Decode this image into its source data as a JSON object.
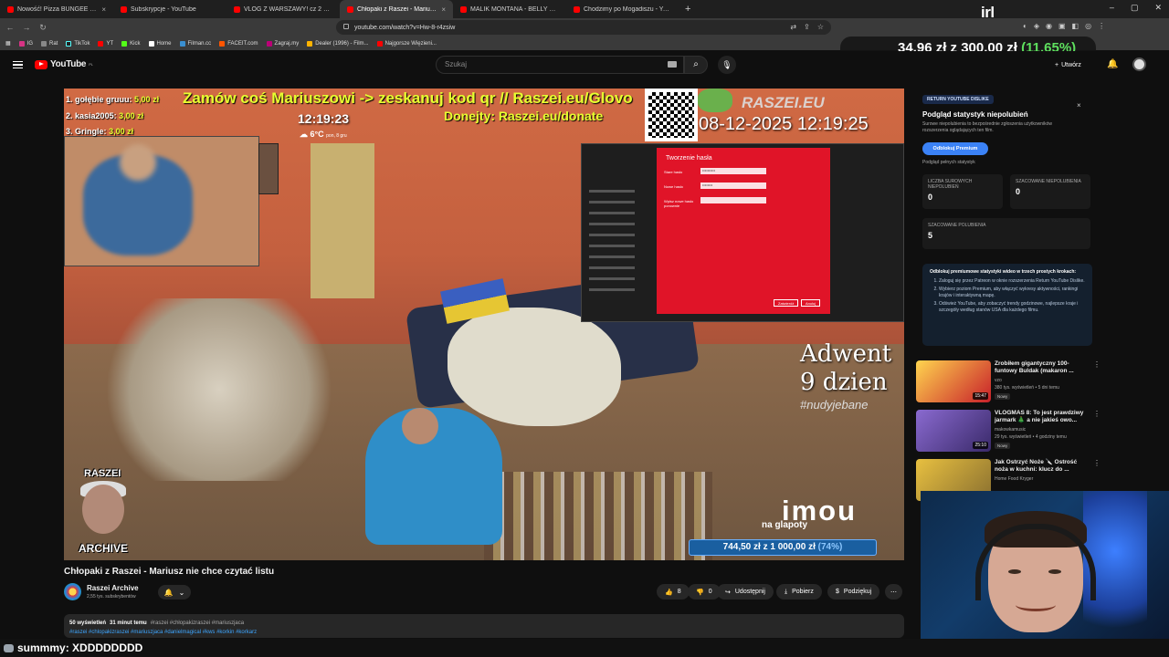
{
  "browser": {
    "tabs": [
      {
        "title": "Nowość! Pizza BUNGEE w Dino 🍕 😮",
        "active": false
      },
      {
        "title": "Subskrypcje - YouTube",
        "active": false
      },
      {
        "title": "VLOG Z WARSZAWY! cz 2 😮 - YouT",
        "active": false
      },
      {
        "title": "Chłopaki z Raszei - Mariusz n",
        "active": true
      },
      {
        "title": "MALIK MONTANA - BELLY DANCE X",
        "active": false
      },
      {
        "title": "Chodzimy po Mogadiszu - YouTube",
        "active": false
      }
    ],
    "url": "youtube.com/watch?v=Hw-8-r4zsiw",
    "stream_logo": "irl",
    "bookmarks": [
      "IG",
      "Rat",
      "TikTok",
      "YT",
      "Kick",
      "Home",
      "Filman.cc",
      "FACEIT.com",
      "Zagraj.my",
      "Dealer (1996) - Film...",
      "Najgorsze Więzieni..."
    ]
  },
  "donation_overlay": {
    "current": "34,96 zł",
    "separator": "z",
    "goal": "300,00 zł",
    "percent": "(11.65%)"
  },
  "yt_header": {
    "logo_text": "YouTube",
    "logo_region": "PL",
    "search_placeholder": "Szukaj",
    "create_label": "Utwórz"
  },
  "video_overlay": {
    "top_banner": "Zamów coś Mariuszowi -> zeskanuj kod qr // Raszei.eu/Glovo",
    "donate_banner": "Donejty: Raszei.eu/donate",
    "clock": "12:19:23",
    "temperature": "6°C",
    "weather_date": "pon, 8 gru",
    "leaderboard": [
      {
        "rank": "1.",
        "name": "gołębie gruuu:",
        "amount": "5,00 zł"
      },
      {
        "rank": "2.",
        "name": "kasia2005:",
        "amount": "3,00 zł"
      },
      {
        "rank": "3.",
        "name": "Gringle:",
        "amount": "3,00 zł"
      }
    ],
    "channel_logo": "RASZEI.EU",
    "cam_date": "08-12-2025 12:19:25",
    "dialog_title": "Tworzenie hasła",
    "dialog_fields": [
      "Stare hasło",
      "Nowe hasło",
      "Wpisz nowe hasło ponownie"
    ],
    "dialog_buttons": [
      "Zatwierdź",
      "Anuluj"
    ],
    "advent_line1": "Adwent",
    "advent_line2": "9 dzien",
    "advent_hashtag": "#nudyjebane",
    "cam_brand": "imou",
    "cam_brand_sub": "na glapoty",
    "goal_bar": {
      "current": "744,50 zł",
      "goal": "1 000,00 zł",
      "percent": "(74%)"
    },
    "archive_top": "RASZEI",
    "archive_bottom": "ARCHIVE"
  },
  "video": {
    "title": "Chłopaki z Raszei - Mariusz nie chce czytać listu",
    "channel": "Raszei Archive",
    "subscribers": "2,55 tys. subskrybentów",
    "likes": "8",
    "dislikes": "0",
    "share_label": "Udostępnij",
    "download_label": "Pobierz",
    "thanks_label": "Podziękuj",
    "views": "50 wyświetleń",
    "age": "31 minut temu",
    "inline_tags": "#raszei #chłopakizraszei #mariuszjaca",
    "tags": "#raszei #chlopakizraszei #mariuszjaca #danielmagical #kws #korkin #korkarz"
  },
  "extension": {
    "badge": "RETURN YOUTUBE DISLIKE",
    "title": "Podgląd statystyk niepolubień",
    "description": "Surowe niepolubienia to bezpośrednie zgłoszenia użytkowników rozszerzenia oglądających ten film.",
    "unlock_label": "Odblokuj Premium",
    "link_label": "Podgląd pełnych statystyk",
    "stats": [
      {
        "label": "LICZBA SUROWYCH NIEPOLUBIEŃ",
        "value": "0"
      },
      {
        "label": "SZACOWANE NIEPOLUBIENIA",
        "value": "0"
      },
      {
        "label": "SZACOWANE POLUBIENIA",
        "value": "5"
      }
    ],
    "promo_title": "Odblokuj premiumowe statystyki wideo w trzech prostych krokach:",
    "promo_steps": [
      "Zaloguj się przez Patreon w oknie rozszerzenia Return YouTube Dislike.",
      "Wybierz poziom Premium, aby włączyć wykresy aktywności, rankingi krajów i interaktywną mapę.",
      "Odśwież YouTube, aby zobaczyć trendy godzinowe, najlepsze kraje i szczegóły według stanów USA dla każdego filmu."
    ]
  },
  "related": [
    {
      "title": "Zrobiłem gigantyczny 100-funtowy Buldak (makaron ...",
      "channel": "vzo",
      "stats": "380 tys. wyświetleń • 5 dni temu",
      "badge": "Nowy",
      "duration": "15:47",
      "color": "#c8202a"
    },
    {
      "title": "VLOGMAS 8: To jest prawdziwy jarmark 🎄 a nie jakieś owo...",
      "channel": "makowkamusic",
      "stats": "29 tys. wyświetleń • 4 godziny temu",
      "badge": "Nowy",
      "duration": "25:10",
      "color": "#6a4aa8"
    },
    {
      "title": "Jak Ostrzyć Noże 🔪 Ostrość noża w kuchni: klucz do ...",
      "channel": "Home Food Kryger",
      "stats": "",
      "badge": "",
      "duration": "",
      "color": "#c8a020"
    }
  ],
  "chat": {
    "user": "summmy",
    "message": ": XDDDDDDDD"
  }
}
